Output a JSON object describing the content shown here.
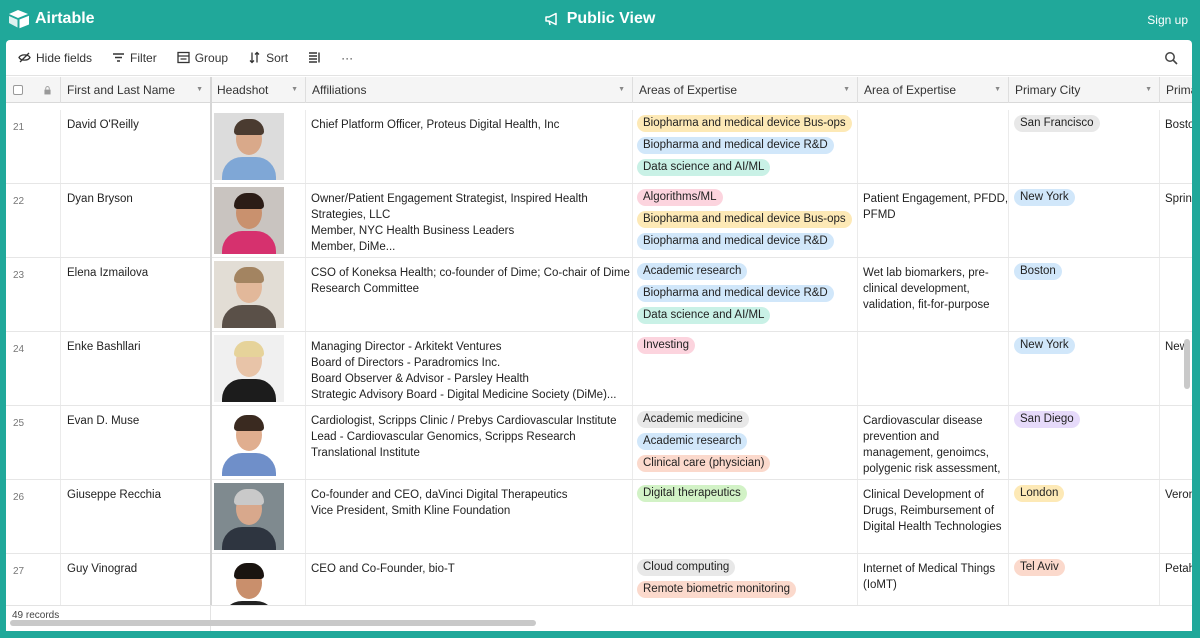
{
  "app": {
    "logo_text": "Airtable",
    "title": "Public View",
    "signup_label": "Sign up",
    "brand_color": "#20a89a"
  },
  "toolbar": {
    "hide_fields_label": "Hide fields",
    "filter_label": "Filter",
    "group_label": "Group",
    "sort_label": "Sort",
    "more_label": "···"
  },
  "columns": {
    "name": "First and Last Name",
    "headshot": "Headshot",
    "affiliations": "Affiliations",
    "areas": "Areas of Expertise",
    "area": "Area of Expertise",
    "city": "Primary City",
    "city2": "Prima"
  },
  "rows": [
    {
      "num": "21",
      "name": "David O'Reilly",
      "affiliations": [
        "Chief Platform Officer, Proteus Digital Health, Inc"
      ],
      "areas": [
        {
          "label": "Biopharma and medical device Bus-ops",
          "color": "#fde9b6"
        },
        {
          "label": "Biopharma and medical device R&D",
          "color": "#d1e7fa"
        },
        {
          "label": "Data science and AI/ML",
          "color": "#c9f1e6"
        }
      ],
      "area_of_expertise": [],
      "city": {
        "label": "San Francisco",
        "color": "#e8e8e8"
      },
      "city2": "Bosto",
      "photo": {
        "bg": "#dcdcdc",
        "skin": "#d9a98a",
        "hair": "#4a3b30",
        "shirt": "#7fa7d6"
      }
    },
    {
      "num": "22",
      "name": "Dyan Bryson",
      "affiliations": [
        "Owner/Patient Engagement Strategist, Inspired Health",
        "Strategies, LLC",
        "Member, NYC Health Business Leaders",
        "Member, DiMe..."
      ],
      "areas": [
        {
          "label": "Algorithms/ML",
          "color": "#fcd4de"
        },
        {
          "label": "Biopharma and medical device Bus-ops",
          "color": "#fde9b6"
        },
        {
          "label": "Biopharma and medical device R&D",
          "color": "#d1e7fa"
        }
      ],
      "area_of_expertise": [
        "Patient Engagement, PFDD,",
        "PFMD"
      ],
      "city": {
        "label": "New York",
        "color": "#d1e7fa"
      },
      "city2": "Sprin",
      "photo": {
        "bg": "#c9c4c0",
        "skin": "#c9916e",
        "hair": "#2b1c16",
        "shirt": "#d6316e"
      }
    },
    {
      "num": "23",
      "name": "Elena Izmailova",
      "affiliations": [
        "CSO of Koneksa Health; co-founder of Dime; Co-chair of Dime",
        "Research Committee"
      ],
      "areas": [
        {
          "label": "Academic research",
          "color": "#d1e7fa"
        },
        {
          "label": "Biopharma and medical device R&D",
          "color": "#d1e7fa"
        },
        {
          "label": "Data science and AI/ML",
          "color": "#c9f1e6"
        }
      ],
      "area_of_expertise": [
        "Wet lab biomarkers, pre-",
        "clinical development,",
        "validation, fit-for-purpose"
      ],
      "city": {
        "label": "Boston",
        "color": "#d1e7fa"
      },
      "city2": "",
      "photo": {
        "bg": "#e2ddd5",
        "skin": "#e2b89a",
        "hair": "#a38461",
        "shirt": "#5a5048"
      }
    },
    {
      "num": "24",
      "name": "Enke Bashllari",
      "affiliations": [
        "Managing Director - Arkitekt Ventures",
        "Board of Directors - Paradromics Inc.",
        "Board Observer & Advisor - Parsley Health",
        "Strategic Advisory Board - Digital Medicine Society (DiMe)..."
      ],
      "areas": [
        {
          "label": "Investing",
          "color": "#fcd4de"
        }
      ],
      "area_of_expertise": [],
      "city": {
        "label": "New York",
        "color": "#d1e7fa"
      },
      "city2": "New",
      "photo": {
        "bg": "#f0f0f0",
        "skin": "#e8c4a8",
        "hair": "#e6d39a",
        "shirt": "#1c1c1c"
      }
    },
    {
      "num": "25",
      "name": "Evan D. Muse",
      "affiliations": [
        "Cardiologist, Scripps Clinic / Prebys Cardiovascular Institute",
        "Lead - Cardiovascular Genomics,  Scripps Research",
        "Translational Institute"
      ],
      "areas": [
        {
          "label": "Academic medicine",
          "color": "#e8e8e8"
        },
        {
          "label": "Academic research",
          "color": "#d1e7fa"
        },
        {
          "label": "Clinical care (physician)",
          "color": "#fbd9cc"
        }
      ],
      "area_of_expertise": [
        "Cardiovascular disease",
        "prevention and",
        "management, genoimcs,",
        "polygenic risk assessment,"
      ],
      "city": {
        "label": "San Diego",
        "color": "#e6dafa"
      },
      "city2": "",
      "photo": {
        "bg": "#ffffff",
        "skin": "#e0ae8f",
        "hair": "#3a2a20",
        "shirt": "#6f8fc9"
      }
    },
    {
      "num": "26",
      "name": "Giuseppe Recchia",
      "affiliations": [
        "Co-founder and CEO, daVinci Digital Therapeutics",
        "Vice President, Smith Kline Foundation"
      ],
      "areas": [
        {
          "label": "Digital therapeutics",
          "color": "#d2f2c6"
        }
      ],
      "area_of_expertise": [
        "Clinical Development of",
        "Drugs, Reimbursement of",
        "Digital Health Technologies"
      ],
      "city": {
        "label": "London",
        "color": "#fde9b6"
      },
      "city2": "Veron",
      "photo": {
        "bg": "#7f8a8f",
        "skin": "#d8a88c",
        "hair": "#c9c9c9",
        "shirt": "#2e3540"
      }
    },
    {
      "num": "27",
      "name": "Guy Vinograd",
      "affiliations": [
        "CEO and Co-Founder, bio-T"
      ],
      "areas": [
        {
          "label": "Cloud computing",
          "color": "#e8e8e8"
        },
        {
          "label": "Remote biometric monitoring",
          "color": "#fbd9cc"
        }
      ],
      "area_of_expertise": [
        "Internet of Medical Things",
        "(IoMT)"
      ],
      "city": {
        "label": "Tel Aviv",
        "color": "#fbd9cc"
      },
      "city2": "Petah",
      "photo": {
        "bg": "#ffffff",
        "skin": "#c98f6c",
        "hair": "#1a1410",
        "shirt": "#222222"
      }
    }
  ],
  "footer": {
    "record_count": "49 records"
  }
}
